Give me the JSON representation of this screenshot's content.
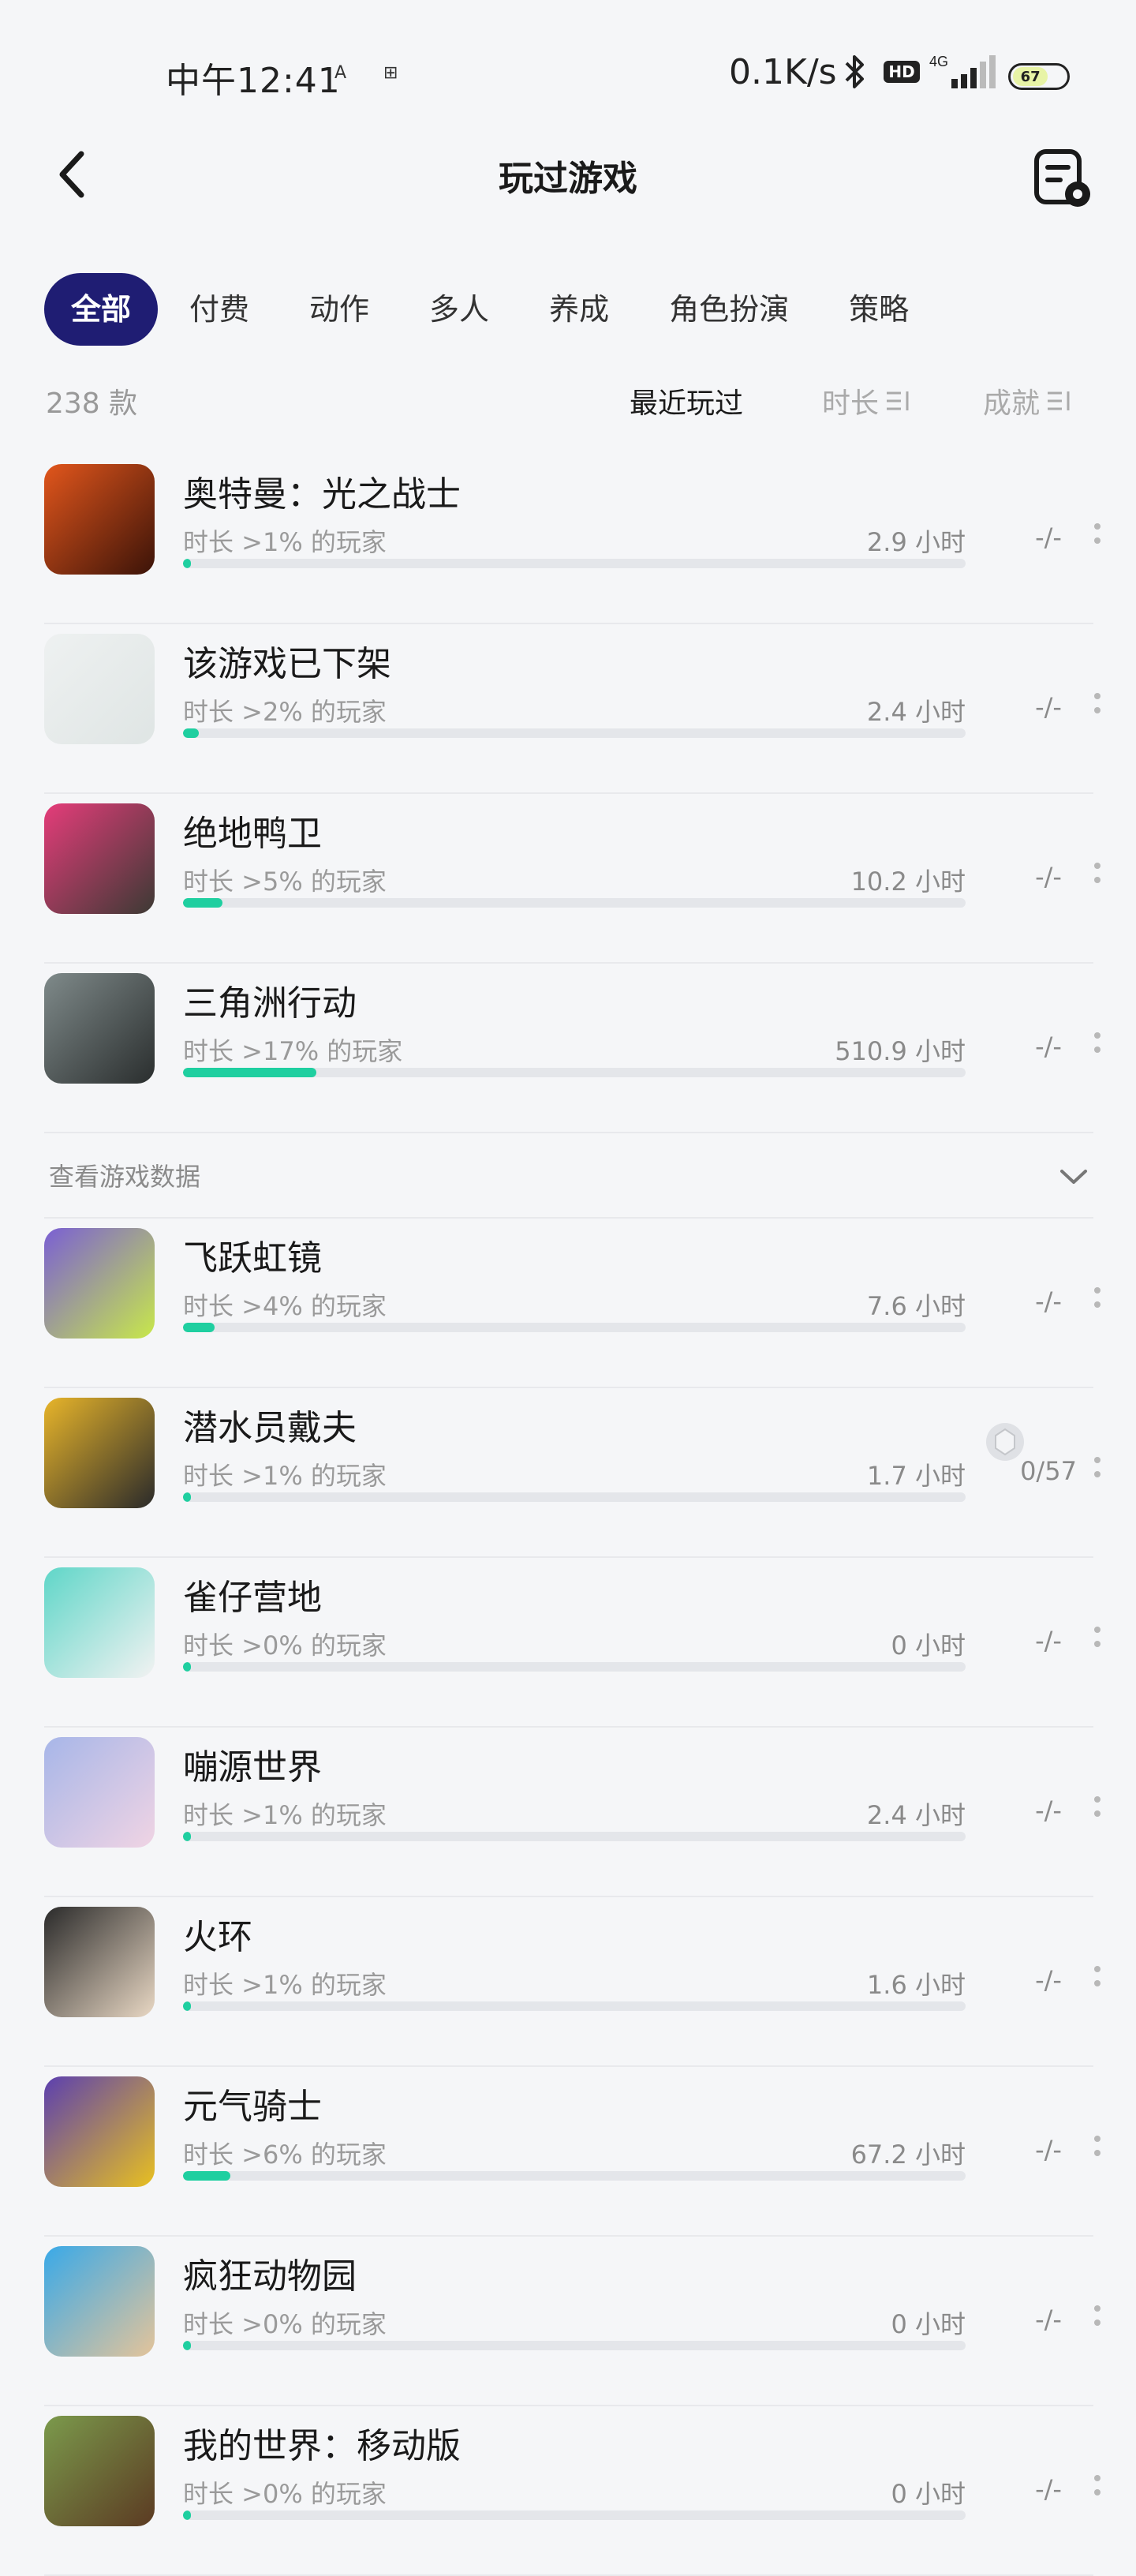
{
  "status_bar": {
    "time": "中午12:41",
    "small_left": "A",
    "small_right": "⊞",
    "net_speed": "0.1K/s",
    "hd": "HD",
    "network": "4G",
    "battery": "67",
    "battery_color": "#e8f4a6"
  },
  "header": {
    "title": "玩过游戏",
    "back_icon": "chevron-left-icon",
    "settings_icon": "list-settings-icon"
  },
  "tabs": [
    {
      "label": "全部",
      "active": true
    },
    {
      "label": "付费"
    },
    {
      "label": "动作"
    },
    {
      "label": "多人"
    },
    {
      "label": "养成"
    },
    {
      "label": "角色扮演"
    },
    {
      "label": "策略"
    }
  ],
  "summary": {
    "count": "238 款",
    "sort_recent": "最近玩过",
    "sort_duration": "时长",
    "sort_achievement": "成就"
  },
  "games_top": [
    {
      "name": "奥特曼：光之战士",
      "stat": "时长 >1% 的玩家",
      "hours": "2.9 小时",
      "achievement": "-/-",
      "progress": 0.01,
      "icon_colors": [
        "#e2561c",
        "#3b1308"
      ]
    },
    {
      "name": "该游戏已下架",
      "stat": "时长 >2% 的玩家",
      "hours": "2.4 小时",
      "achievement": "-/-",
      "progress": 0.02,
      "icon_colors": [
        "#eef1f1",
        "#dfe5e4"
      ]
    },
    {
      "name": "绝地鸭卫",
      "stat": "时长 >5% 的玩家",
      "hours": "10.2 小时",
      "achievement": "-/-",
      "progress": 0.05,
      "icon_colors": [
        "#e53c7a",
        "#3c3a34"
      ]
    },
    {
      "name": "三角洲行动",
      "stat": "时长 >17% 的玩家",
      "hours": "510.9 小时",
      "achievement": "-/-",
      "progress": 0.17,
      "icon_colors": [
        "#7f8a8a",
        "#2a2e2e"
      ]
    }
  ],
  "section": {
    "label": "查看游戏数据"
  },
  "games_bottom": [
    {
      "name": "飞跃虹镜",
      "stat": "时长 >4% 的玩家",
      "hours": "7.6 小时",
      "achievement": "-/-",
      "progress": 0.04,
      "icon_colors": [
        "#7a5fd4",
        "#c8e84a"
      ]
    },
    {
      "name": "潜水员戴夫",
      "stat": "时长 >1% 的玩家",
      "hours": "1.7 小时",
      "achievement": "0/57",
      "has_achievement_icon": true,
      "progress": 0.01,
      "icon_colors": [
        "#e8b52a",
        "#2a2a2a"
      ]
    },
    {
      "name": "雀仔营地",
      "stat": "时长 >0% 的玩家",
      "hours": "0 小时",
      "achievement": "-/-",
      "progress": 0.0,
      "icon_colors": [
        "#5fd6c8",
        "#f2f2f2"
      ]
    },
    {
      "name": "嘣源世界",
      "stat": "时长 >1% 的玩家",
      "hours": "2.4 小时",
      "achievement": "-/-",
      "progress": 0.01,
      "icon_colors": [
        "#a7b6e8",
        "#f0d4e4"
      ]
    },
    {
      "name": "火环",
      "stat": "时长 >1% 的玩家",
      "hours": "1.6 小时",
      "achievement": "-/-",
      "progress": 0.01,
      "icon_colors": [
        "#2a2a2a",
        "#e9d8c4"
      ]
    },
    {
      "name": "元气骑士",
      "stat": "时长 >6% 的玩家",
      "hours": "67.2 小时",
      "achievement": "-/-",
      "progress": 0.06,
      "icon_colors": [
        "#5b3fb0",
        "#e8c020"
      ]
    },
    {
      "name": "疯狂动物园",
      "stat": "时长 >0% 的玩家",
      "hours": "0 小时",
      "achievement": "-/-",
      "progress": 0.0,
      "icon_colors": [
        "#39a9e8",
        "#e4c49a"
      ]
    },
    {
      "name": "我的世界：移动版",
      "stat": "时长 >0% 的玩家",
      "hours": "0 小时",
      "achievement": "-/-",
      "progress": 0.0,
      "icon_colors": [
        "#7b9a4c",
        "#5b3a22"
      ]
    }
  ]
}
